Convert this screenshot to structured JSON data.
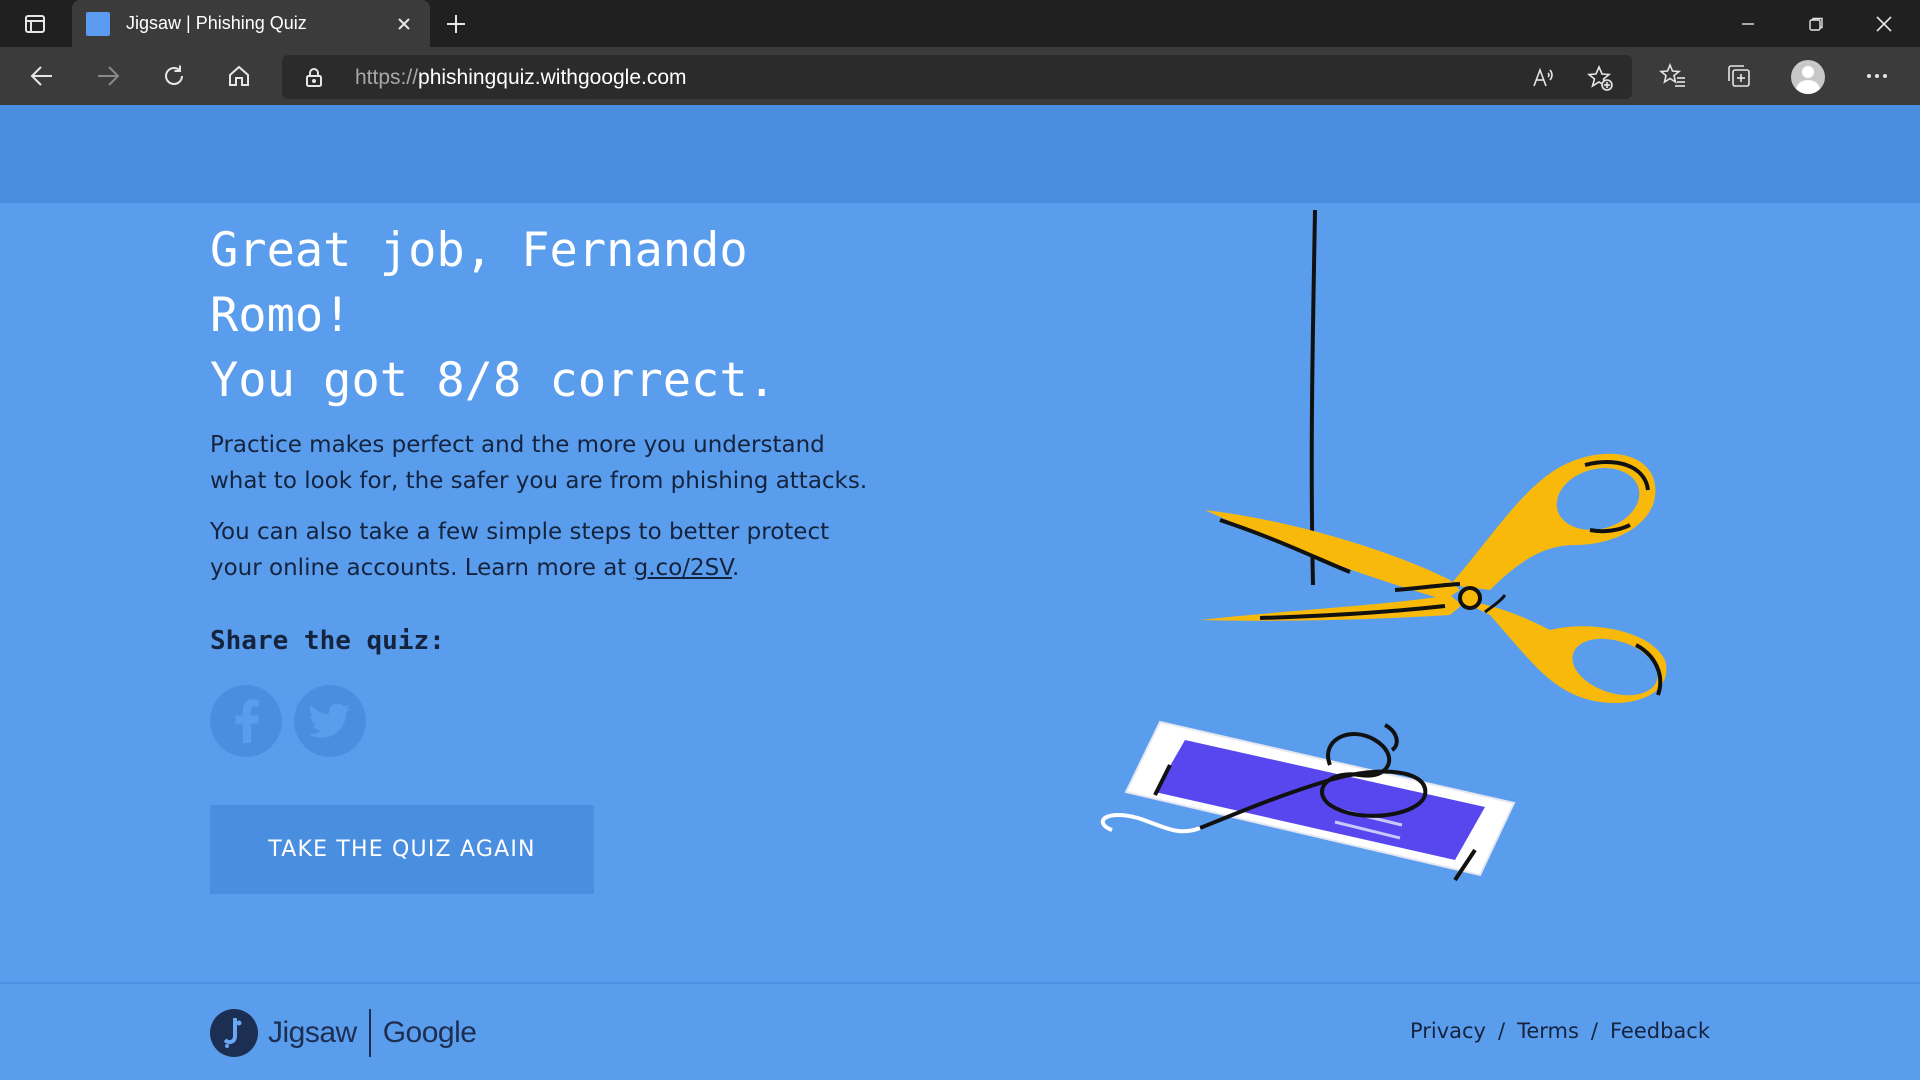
{
  "browser": {
    "tab_title": "Jigsaw | Phishing Quiz",
    "url_protocol": "https://",
    "url_host": "phishingquiz.withgoogle.com",
    "icons": {
      "tab_actions": "tab-actions-icon",
      "close_tab": "close-icon",
      "new_tab": "plus-icon",
      "back": "arrow-left-icon",
      "forward": "arrow-right-icon",
      "refresh": "refresh-icon",
      "home": "home-icon",
      "lock": "lock-icon",
      "read_aloud": "read-aloud-icon",
      "add_favorite": "star-plus-icon",
      "favorites": "favorites-icon",
      "collections": "collections-icon",
      "profile": "avatar-icon",
      "menu": "more-icon"
    }
  },
  "result": {
    "line1": "Great job, Fernando",
    "line2": "Romo!",
    "line3": "You got 8/8 correct."
  },
  "body": {
    "para1": "Practice makes perfect and the more you understand what to look for, the safer you are from phishing attacks.",
    "para2_prefix": "You can also take a few simple steps to better protect your online accounts. Learn more at ",
    "para2_link": "g.co/2SV",
    "para2_suffix": "."
  },
  "share": {
    "label": "Share the quiz:",
    "facebook_icon": "facebook-icon",
    "twitter_icon": "twitter-icon"
  },
  "retake_button": "TAKE THE QUIZ AGAIN",
  "footer": {
    "jigsaw": "Jigsaw",
    "google": "Google",
    "links": [
      "Privacy",
      "Terms",
      "Feedback"
    ],
    "separator": "/"
  },
  "colors": {
    "page_bg": "#5b9ded",
    "header_band": "#4a8ee0",
    "button_bg": "#4a8ee0",
    "scissors": "#f9b90b",
    "phone_screen": "#5847ee",
    "text_dark": "#14233e"
  }
}
